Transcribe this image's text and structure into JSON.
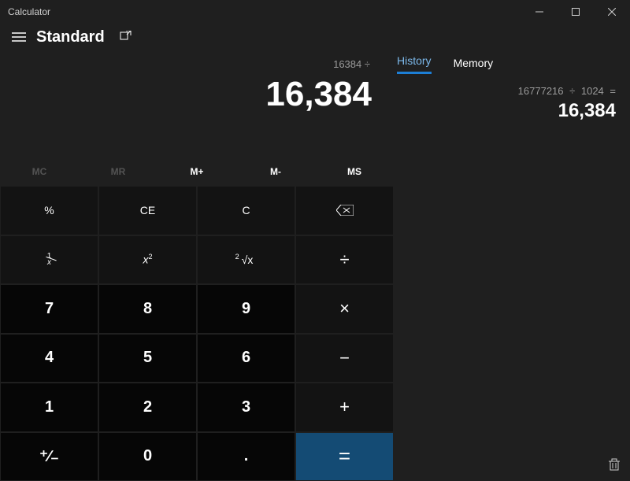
{
  "window": {
    "title": "Calculator"
  },
  "header": {
    "mode": "Standard"
  },
  "display": {
    "expression": "16384 ÷",
    "result": "16,384"
  },
  "memory": {
    "mc": "MC",
    "mr": "MR",
    "mplus": "M+",
    "mminus": "M-",
    "ms": "MS"
  },
  "buttons": {
    "percent": "%",
    "ce": "CE",
    "c": "C",
    "recip_n": "1",
    "recip_d": "x",
    "sq_base": "x",
    "sq_exp": "2",
    "root_idx": "2",
    "root_rad": "√x",
    "div": "÷",
    "mul": "×",
    "sub": "−",
    "add": "+",
    "eq": "=",
    "n7": "7",
    "n8": "8",
    "n9": "9",
    "n4": "4",
    "n5": "5",
    "n6": "6",
    "n1": "1",
    "n2": "2",
    "n3": "3",
    "n0": "0",
    "dot": ".",
    "neg": "⁺∕₋"
  },
  "side": {
    "tab_history": "History",
    "tab_memory": "Memory",
    "history": [
      {
        "expr": "16777216   ÷   1024  =",
        "result": "16,384"
      }
    ]
  }
}
